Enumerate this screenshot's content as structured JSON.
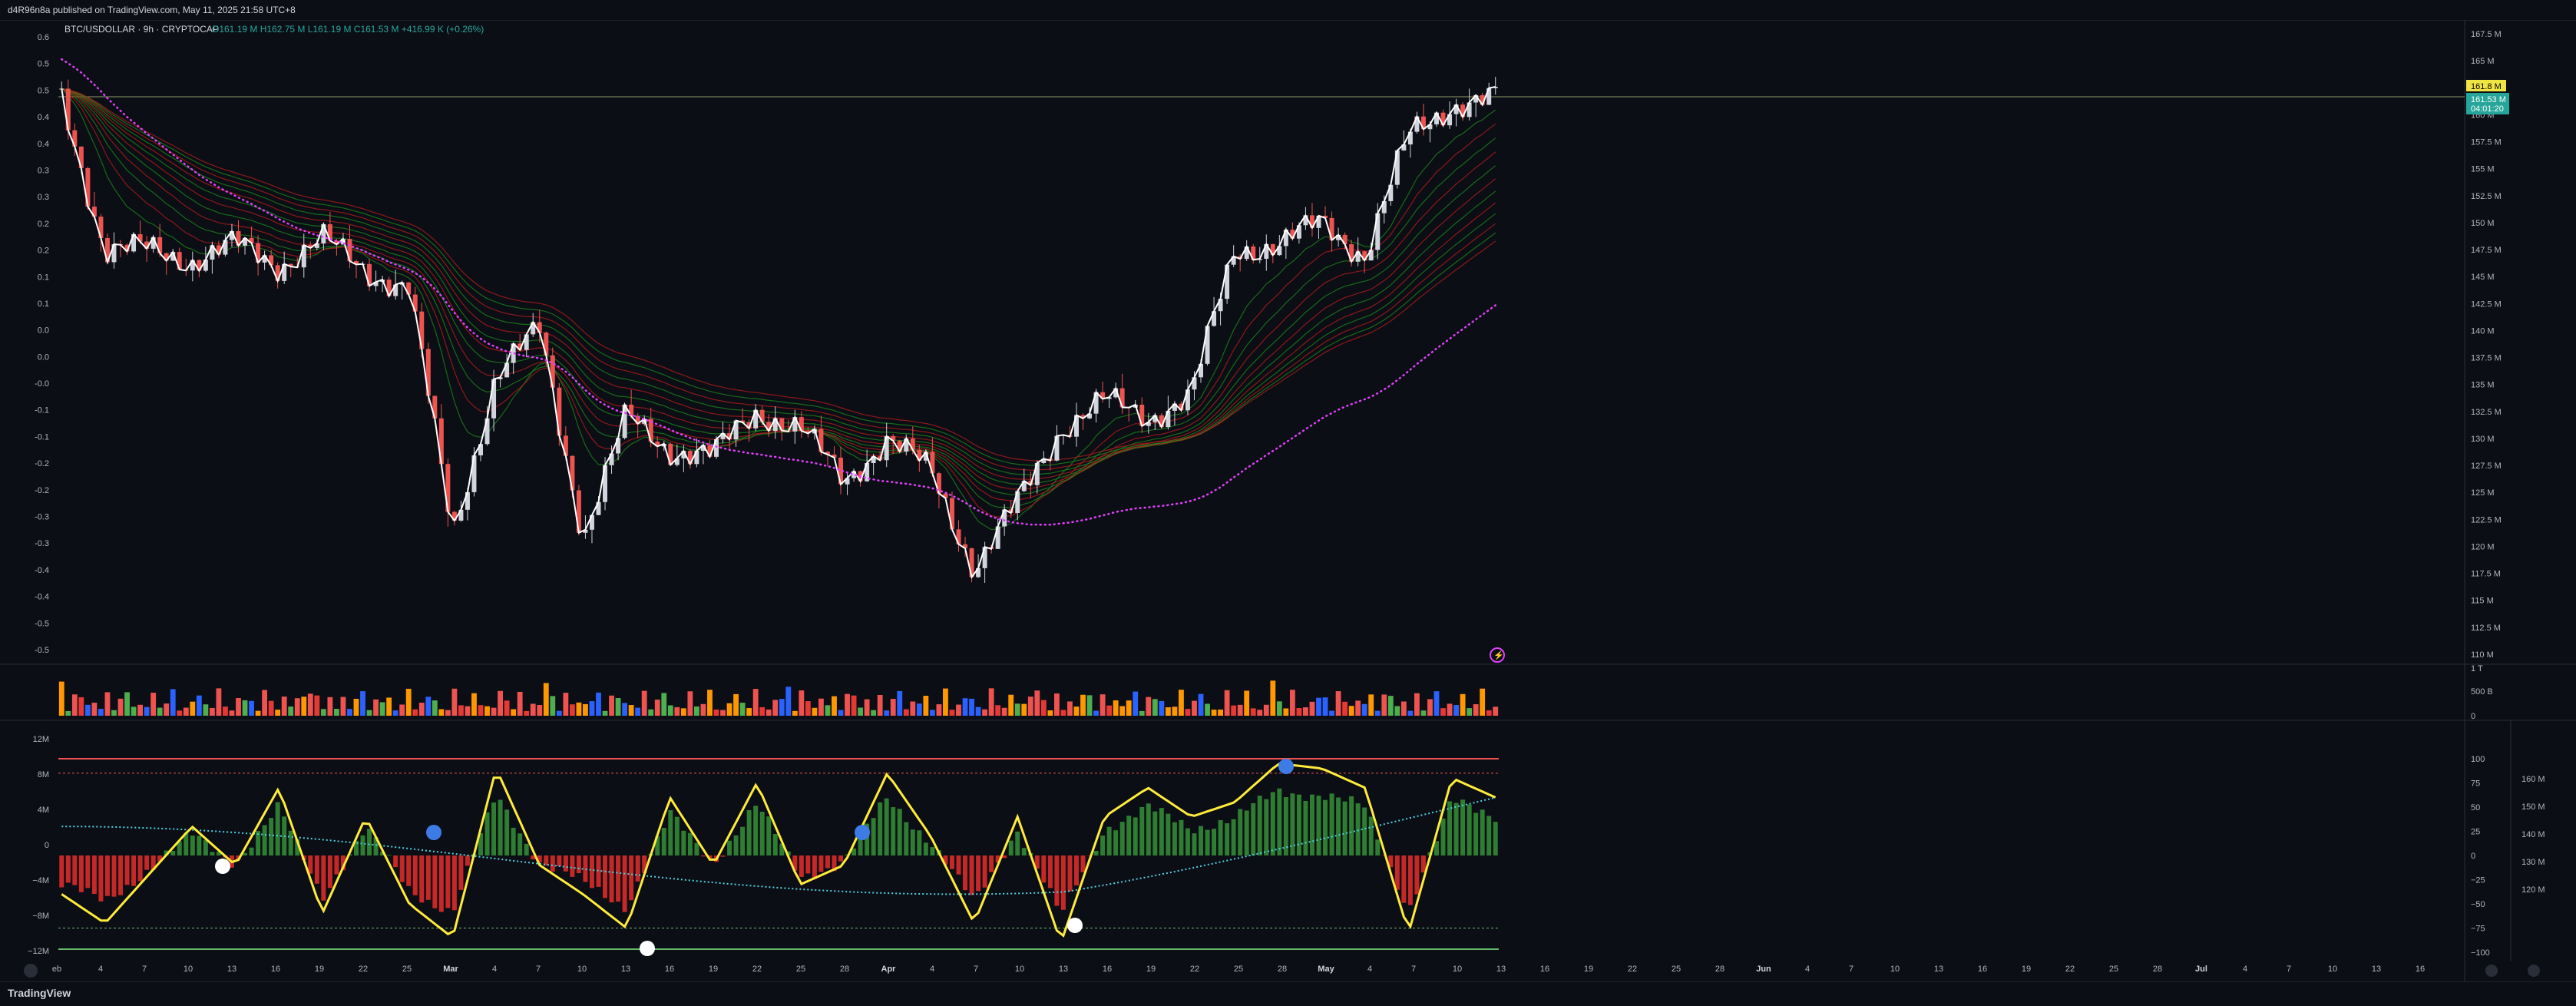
{
  "header": {
    "published_text": "d4R96n8a published on TradingView.com, May 11, 2025 21:58 UTC+8"
  },
  "legend": {
    "symbol": "BTC/USDOLLAR · 9h · CRYPTOCAP",
    "ohlc": "O161.19 M  H162.75 M  L161.19 M  C161.53 M  +416.99 K (+0.26%)"
  },
  "price_axis": {
    "ticks": [
      "167.5 M",
      "165 M",
      "162.5 M",
      "160 M",
      "157.5 M",
      "155 M",
      "152.5 M",
      "150 M",
      "147.5 M",
      "145 M",
      "142.5 M",
      "140 M",
      "137.5 M",
      "135 M",
      "132.5 M",
      "130 M",
      "127.5 M",
      "125 M",
      "122.5 M",
      "120 M",
      "117.5 M",
      "115 M",
      "112.5 M",
      "110 M"
    ],
    "last_label": "161.8 M",
    "current_label": "161.53 M",
    "countdown": "04:01:20"
  },
  "left_axis": {
    "ticks": [
      "0.6",
      "0.5",
      "0.5",
      "0.4",
      "0.4",
      "0.3",
      "0.3",
      "0.2",
      "0.2",
      "0.1",
      "0.1",
      "0.0",
      "0.0",
      "-0.0",
      "-0.1",
      "-0.1",
      "-0.2",
      "-0.2",
      "-0.3",
      "-0.3",
      "-0.4",
      "-0.4",
      "-0.5",
      "-0.5"
    ]
  },
  "volume_axis": {
    "ticks": [
      "1 T",
      "500 B",
      "0"
    ]
  },
  "osc_left_axis": {
    "ticks": [
      "12M",
      "8M",
      "4M",
      "0",
      "−4M",
      "−8M",
      "−12M"
    ]
  },
  "osc_right_axis": {
    "ticks": [
      "100",
      "75",
      "50",
      "25",
      "0",
      "−25",
      "−50",
      "−75",
      "−100"
    ]
  },
  "osc_far_axis": {
    "ticks": [
      "160 M",
      "150 M",
      "140 M",
      "130 M",
      "120 M"
    ]
  },
  "time_axis": {
    "ticks": [
      "eb",
      "4",
      "7",
      "10",
      "13",
      "16",
      "19",
      "22",
      "25",
      "Mar",
      "4",
      "7",
      "10",
      "13",
      "16",
      "19",
      "22",
      "25",
      "28",
      "Apr",
      "4",
      "7",
      "10",
      "13",
      "16",
      "19",
      "22",
      "25",
      "28",
      "May",
      "4",
      "7",
      "10",
      "13",
      "16",
      "19",
      "22",
      "25",
      "28",
      "Jun",
      "4",
      "7",
      "10",
      "13",
      "16",
      "19",
      "22",
      "25",
      "28",
      "Jul",
      "4",
      "7",
      "10",
      "13",
      "16"
    ]
  },
  "footer": {
    "brand": "TradingView"
  },
  "colors": {
    "bull": "#26a69a",
    "bear": "#ef5350",
    "price_line": "#ffffff",
    "ma_bull": "#1b8a1b",
    "ma_bear": "#b71c1c",
    "osc_line": "#ffeb3b",
    "dotted_signal": "#4dd0e1",
    "trail": "#e040fb"
  },
  "chart_data": {
    "type": "line",
    "title": "BTC/USDOLLAR · 9h · CRYPTOCAP",
    "ylabel": "",
    "ylim": [
      110,
      167.5
    ],
    "x": [
      "Feb 1",
      "Feb 4",
      "Feb 7",
      "Feb 10",
      "Feb 13",
      "Feb 16",
      "Feb 19",
      "Feb 22",
      "Feb 25",
      "Feb 28",
      "Mar 4",
      "Mar 7",
      "Mar 10",
      "Mar 13",
      "Mar 16",
      "Mar 19",
      "Mar 22",
      "Mar 25",
      "Mar 28",
      "Apr 1",
      "Apr 4",
      "Apr 7",
      "Apr 10",
      "Apr 13",
      "Apr 16",
      "Apr 19",
      "Apr 22",
      "Apr 25",
      "Apr 28",
      "May 1",
      "May 4",
      "May 7",
      "May 10",
      "May 11"
    ],
    "series": [
      {
        "name": "BTC/USDOLLAR",
        "values": [
          161.5,
          147.5,
          147.5,
          146.5,
          148,
          146,
          148.5,
          145.5,
          144,
          121,
          136,
          140,
          121,
          132,
          129,
          128.5,
          132.5,
          131,
          126,
          130,
          127,
          118,
          124,
          131,
          133.5,
          132,
          134,
          147.5,
          148,
          150,
          147,
          158,
          161,
          161.5
        ]
      }
    ],
    "oscillator": {
      "ylim": [
        -100,
        100
      ],
      "values": [
        -40,
        -70,
        -20,
        30,
        -10,
        70,
        -60,
        40,
        -50,
        -85,
        90,
        -10,
        -40,
        -75,
        60,
        -10,
        75,
        -30,
        -10,
        85,
        20,
        -70,
        40,
        -90,
        40,
        70,
        40,
        55,
        95,
        90,
        70,
        -80,
        80,
        60
      ],
      "upper_band": 85,
      "lower_band": -75
    },
    "volume": {
      "ylim": [
        0,
        1000
      ],
      "unit": "B"
    }
  }
}
